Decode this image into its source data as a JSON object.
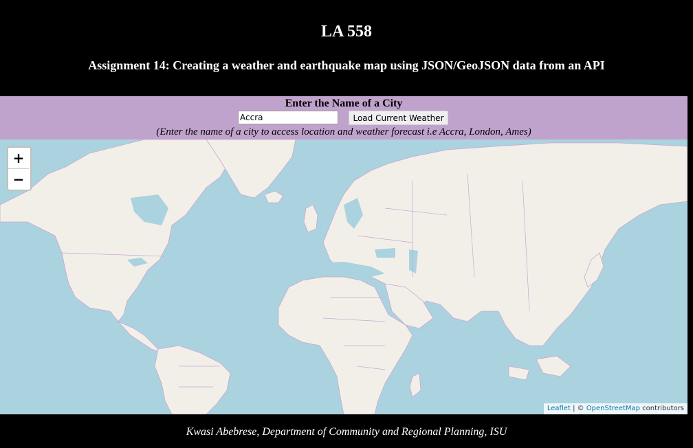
{
  "header": {
    "course": "LA 558",
    "assignment": "Assignment 14: Creating a weather and earthquake map using JSON/GeoJSON data from an API"
  },
  "city_form": {
    "label": "Enter the Name of a City",
    "input_value": "Accra",
    "button_label": "Load Current Weather",
    "hint": "(Enter the name of a city to access location and weather forecast i.e Accra, London, Ames)"
  },
  "map": {
    "zoom_in": "+",
    "zoom_out": "−",
    "attribution": {
      "leaflet": "Leaflet",
      "separator": " | © ",
      "osm": "OpenStreetMap",
      "suffix": " contributors"
    },
    "colors": {
      "water": "#aad3df",
      "land": "#f2efe9",
      "border": "#c9a6cf"
    }
  },
  "footer": {
    "text": "Kwasi Abebrese, Department of Community and Regional Planning, ISU"
  }
}
